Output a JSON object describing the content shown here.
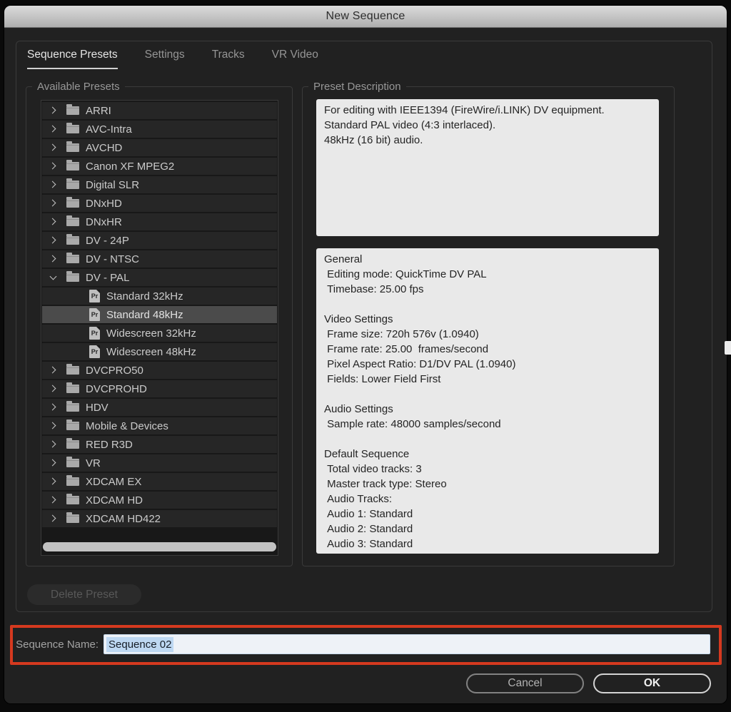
{
  "window": {
    "title": "New Sequence"
  },
  "tabs": [
    {
      "label": "Sequence Presets",
      "active": true
    },
    {
      "label": "Settings",
      "active": false
    },
    {
      "label": "Tracks",
      "active": false
    },
    {
      "label": "VR Video",
      "active": false
    }
  ],
  "presets_panel": {
    "legend": "Available Presets",
    "items": [
      {
        "type": "folder",
        "label": "ARRI",
        "expanded": false
      },
      {
        "type": "folder",
        "label": "AVC-Intra",
        "expanded": false
      },
      {
        "type": "folder",
        "label": "AVCHD",
        "expanded": false
      },
      {
        "type": "folder",
        "label": "Canon XF MPEG2",
        "expanded": false
      },
      {
        "type": "folder",
        "label": "Digital SLR",
        "expanded": false
      },
      {
        "type": "folder",
        "label": "DNxHD",
        "expanded": false
      },
      {
        "type": "folder",
        "label": "DNxHR",
        "expanded": false
      },
      {
        "type": "folder",
        "label": "DV - 24P",
        "expanded": false
      },
      {
        "type": "folder",
        "label": "DV - NTSC",
        "expanded": false
      },
      {
        "type": "folder",
        "label": "DV - PAL",
        "expanded": true
      },
      {
        "type": "preset",
        "label": "Standard 32kHz",
        "selected": false
      },
      {
        "type": "preset",
        "label": "Standard 48kHz",
        "selected": true
      },
      {
        "type": "preset",
        "label": "Widescreen 32kHz",
        "selected": false
      },
      {
        "type": "preset",
        "label": "Widescreen 48kHz",
        "selected": false
      },
      {
        "type": "folder",
        "label": "DVCPRO50",
        "expanded": false
      },
      {
        "type": "folder",
        "label": "DVCPROHD",
        "expanded": false
      },
      {
        "type": "folder",
        "label": "HDV",
        "expanded": false
      },
      {
        "type": "folder",
        "label": "Mobile & Devices",
        "expanded": false
      },
      {
        "type": "folder",
        "label": "RED R3D",
        "expanded": false
      },
      {
        "type": "folder",
        "label": "VR",
        "expanded": false
      },
      {
        "type": "folder",
        "label": "XDCAM EX",
        "expanded": false
      },
      {
        "type": "folder",
        "label": "XDCAM HD",
        "expanded": false
      },
      {
        "type": "folder",
        "label": "XDCAM HD422",
        "expanded": false
      }
    ]
  },
  "description_panel": {
    "legend": "Preset Description",
    "summary_lines": [
      "For editing with IEEE1394 (FireWire/i.LINK) DV equipment.",
      "Standard PAL video (4:3 interlaced).",
      "48kHz (16 bit) audio."
    ],
    "details_lines": [
      "General",
      " Editing mode: QuickTime DV PAL",
      " Timebase: 25.00 fps",
      "",
      "Video Settings",
      " Frame size: 720h 576v (1.0940)",
      " Frame rate: 25.00  frames/second",
      " Pixel Aspect Ratio: D1/DV PAL (1.0940)",
      " Fields: Lower Field First",
      "",
      "Audio Settings",
      " Sample rate: 48000 samples/second",
      "",
      "Default Sequence",
      " Total video tracks: 3",
      " Master track type: Stereo",
      " Audio Tracks:",
      " Audio 1: Standard",
      " Audio 2: Standard",
      " Audio 3: Standard"
    ]
  },
  "buttons": {
    "delete_preset": "Delete Preset",
    "cancel": "Cancel",
    "ok": "OK"
  },
  "sequence_name": {
    "label": "Sequence Name:",
    "value": "Sequence 02"
  },
  "icons": {
    "preset_icon_text": "Pr"
  },
  "colors": {
    "annotation_box": "#d5391f",
    "text_selection": "#bed8f2",
    "selected_row": "#4b4b4b"
  }
}
